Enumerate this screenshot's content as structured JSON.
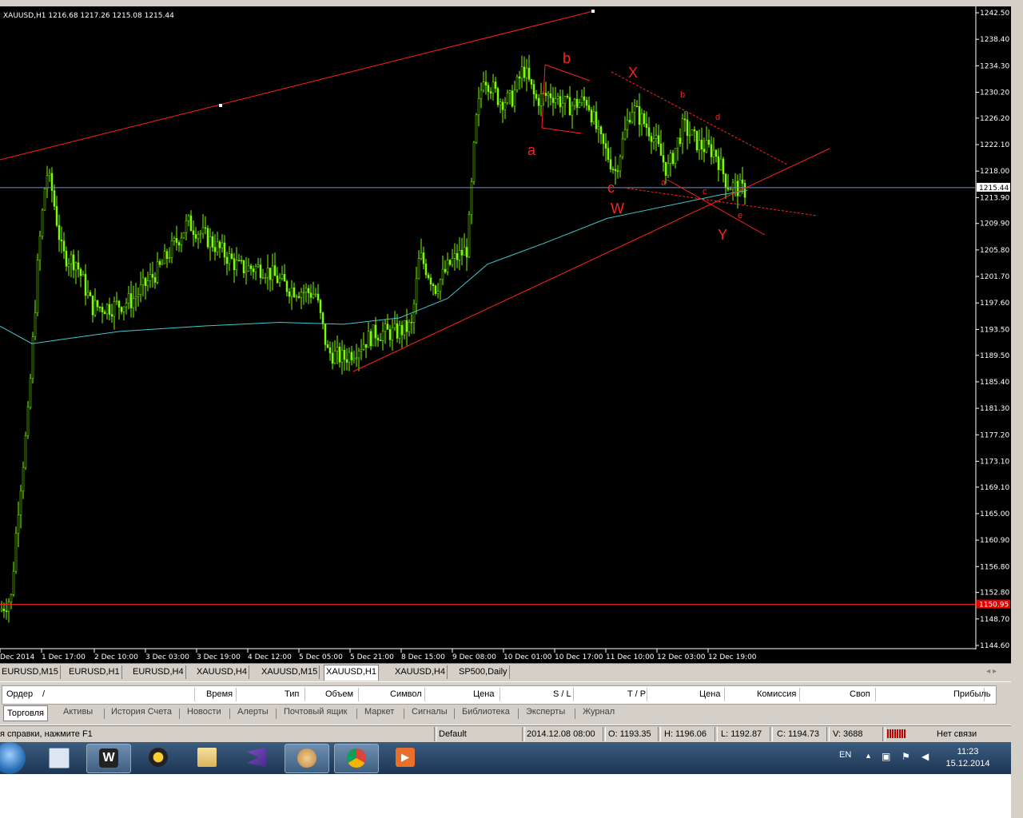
{
  "chart": {
    "symbol_info": "XAUUSD,H1  1216.68 1217.26 1215.08 1215.44",
    "current_price_label": "1215.44",
    "red_level_label": "1150.95",
    "price_ticks": [
      "1242.50",
      "1238.40",
      "1234.30",
      "1230.20",
      "1226.20",
      "1222.10",
      "1218.00",
      "1213.90",
      "1209.90",
      "1205.80",
      "1201.70",
      "1197.60",
      "1193.50",
      "1189.50",
      "1185.40",
      "1181.30",
      "1177.20",
      "1173.10",
      "1169.10",
      "1165.00",
      "1160.90",
      "1156.80",
      "1152.80",
      "1148.70",
      "1144.60"
    ],
    "time_ticks": [
      "Dec 2014",
      "1 Dec 17:00",
      "2 Dec 10:00",
      "3 Dec 03:00",
      "3 Dec 19:00",
      "4 Dec 12:00",
      "5 Dec 05:00",
      "5 Dec 21:00",
      "8 Dec 15:00",
      "9 Dec 08:00",
      "10 Dec 01:00",
      "10 Dec 17:00",
      "11 Dec 10:00",
      "12 Dec 03:00",
      "12 Dec 19:00"
    ],
    "wave_labels": [
      {
        "text": "b",
        "kind": "large"
      },
      {
        "text": "X",
        "kind": "large"
      },
      {
        "text": "b",
        "kind": "small"
      },
      {
        "text": "d",
        "kind": "small"
      },
      {
        "text": "a",
        "kind": "large"
      },
      {
        "text": "c",
        "kind": "large"
      },
      {
        "text": "W",
        "kind": "large"
      },
      {
        "text": "a",
        "kind": "small"
      },
      {
        "text": "c",
        "kind": "small"
      },
      {
        "text": "e",
        "kind": "small"
      },
      {
        "text": "Y",
        "kind": "large"
      }
    ],
    "colors": {
      "background": "#000000",
      "candles": "#7cfc00",
      "ma": "#40c8d0",
      "annotations": "#ff2020",
      "price_line": "#8090b0"
    }
  },
  "chart_tabs": [
    {
      "label": "EURUSD,M15",
      "active": false
    },
    {
      "label": "EURUSD,H1",
      "active": false
    },
    {
      "label": "EURUSD,H4",
      "active": false
    },
    {
      "label": "XAUUSD,H4",
      "active": false
    },
    {
      "label": "XAUUSD,M15",
      "active": false
    },
    {
      "label": "XAUUSD,H1",
      "active": true
    },
    {
      "label": "XAUUSD,H4",
      "active": false
    },
    {
      "label": "SP500,Daily",
      "active": false
    }
  ],
  "terminal": {
    "columns": [
      "Ордер",
      "/",
      "Время",
      "Тип",
      "Объем",
      "Символ",
      "Цена",
      "S / L",
      "T / P",
      "Цена",
      "Комиссия",
      "Своп",
      "Прибыль"
    ],
    "tabs": [
      "Торговля",
      "Активы",
      "История Счета",
      "Новости",
      "Алерты",
      "Почтовый ящик",
      "Маркет",
      "Сигналы",
      "Библиотека",
      "Эксперты",
      "Журнал"
    ]
  },
  "status": {
    "help": "я справки, нажмите F1",
    "profile": "Default",
    "datetime": "2014.12.08 08:00",
    "open": "O: 1193.35",
    "high": "H: 1196.06",
    "low": "L: 1192.87",
    "close": "C: 1194.73",
    "volume": "V: 3688",
    "connection": "Нет связи"
  },
  "taskbar": {
    "language": "EN",
    "time": "11:23",
    "date": "15.12.2014"
  }
}
